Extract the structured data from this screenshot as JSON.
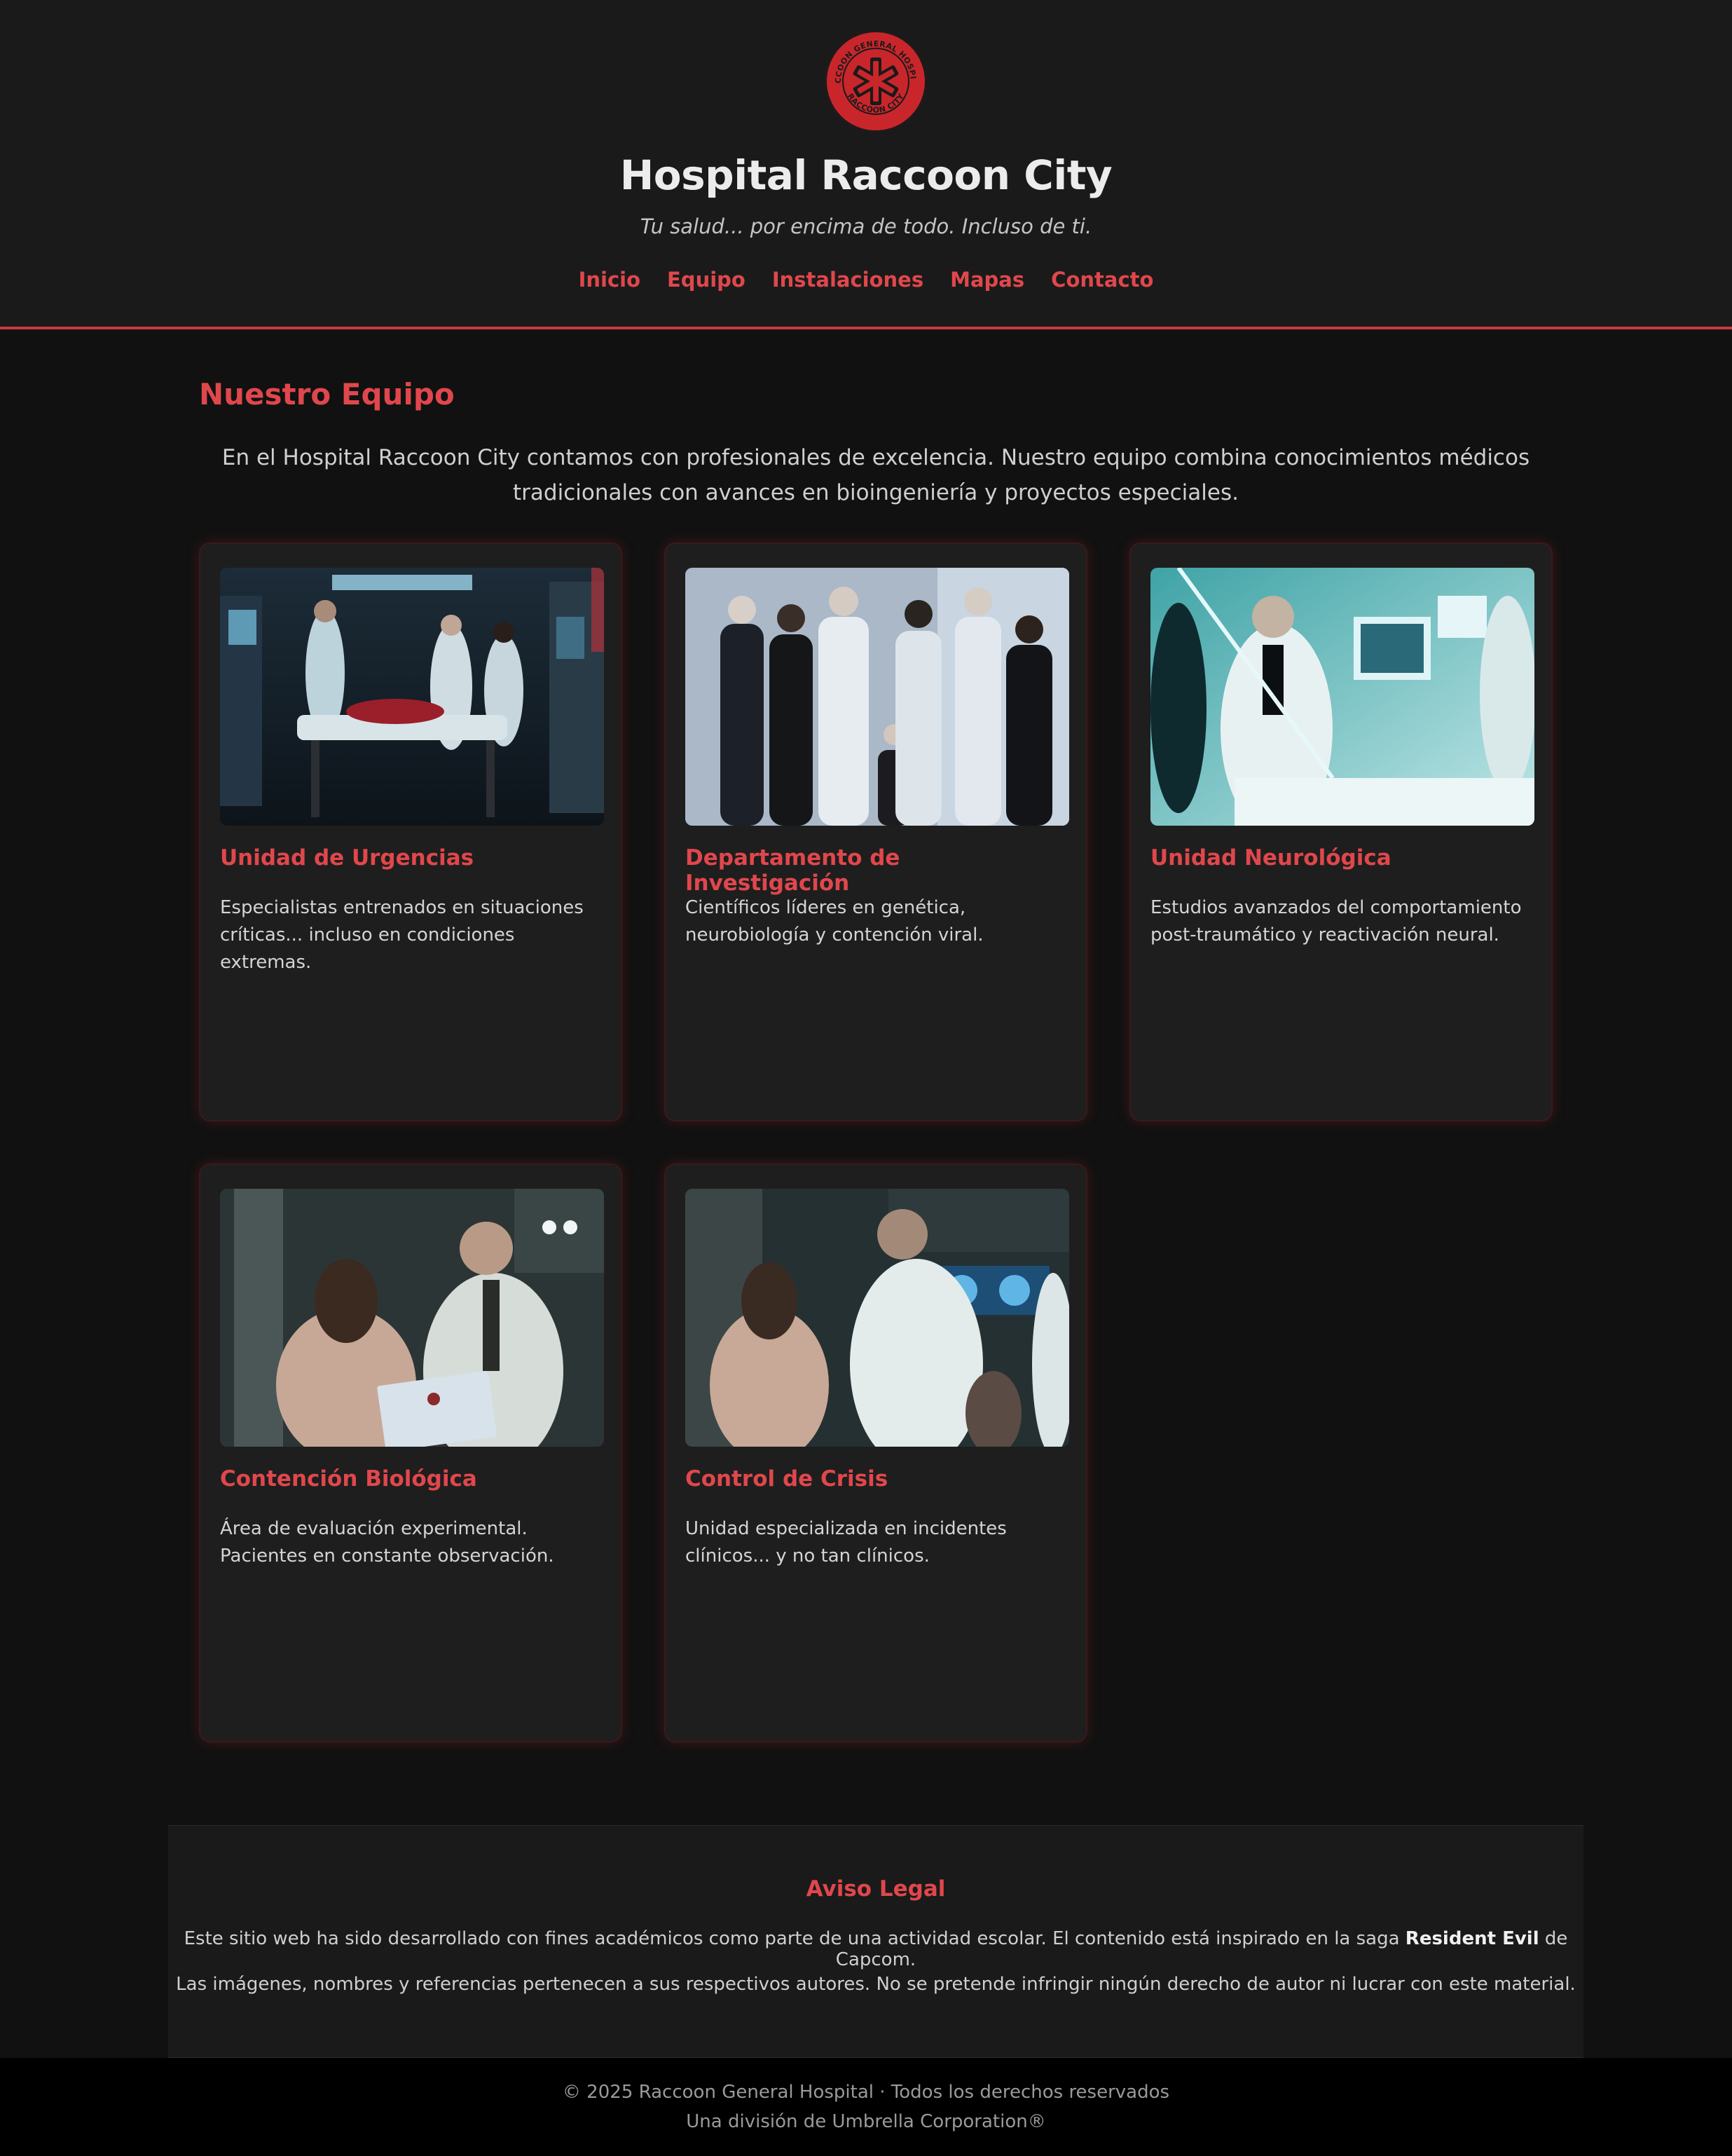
{
  "header": {
    "logo_text_top": "RACCOON GENERAL HOSPITAL",
    "logo_text_bottom": "RACCOON CITY",
    "title": "Hospital Raccoon City",
    "tagline": "Tu salud... por encima de todo. Incluso de ti.",
    "nav": [
      "Inicio",
      "Equipo",
      "Instalaciones",
      "Mapas",
      "Contacto"
    ]
  },
  "main": {
    "section_title": "Nuestro Equipo",
    "intro": "En el Hospital Raccoon City contamos con profesionales de excelencia. Nuestro equipo combina conocimientos médicos tradicionales con avances en bioingeniería y proyectos especiales.",
    "cards": [
      {
        "title": "Unidad de Urgencias",
        "description": "Especialistas entrenados en situaciones críticas... incluso en condiciones extremas."
      },
      {
        "title": "Departamento de Investigación",
        "description": "Científicos líderes en genética, neurobiología y contención viral."
      },
      {
        "title": "Unidad Neurológica",
        "description": "Estudios avanzados del comportamiento post-traumático y reactivación neural."
      },
      {
        "title": "Contención Biológica",
        "description": "Área de evaluación experimental. Pacientes en constante observación."
      },
      {
        "title": "Control de Crisis",
        "description": "Unidad especializada en incidentes clínicos... y no tan clínicos."
      }
    ]
  },
  "legal": {
    "title": "Aviso Legal",
    "p1_before": "Este sitio web ha sido desarrollado con fines académicos como parte de una actividad escolar. El contenido está inspirado en la saga ",
    "p1_bold": "Resident Evil",
    "p1_after": " de Capcom.",
    "p2": "Las imágenes, nombres y referencias pertenecen a sus respectivos autores. No se pretende infringir ningún derecho de autor ni lucrar con este material."
  },
  "footer": {
    "copyright": "© 2025 Raccoon General Hospital · Todos los derechos reservados",
    "division": "Una división de Umbrella Corporation®"
  },
  "colors": {
    "accent": "#e0474c",
    "header_bg": "#1a1a1a",
    "page_bg": "#111111",
    "card_bg": "#1e1e1e",
    "footer_bg": "#000000"
  }
}
